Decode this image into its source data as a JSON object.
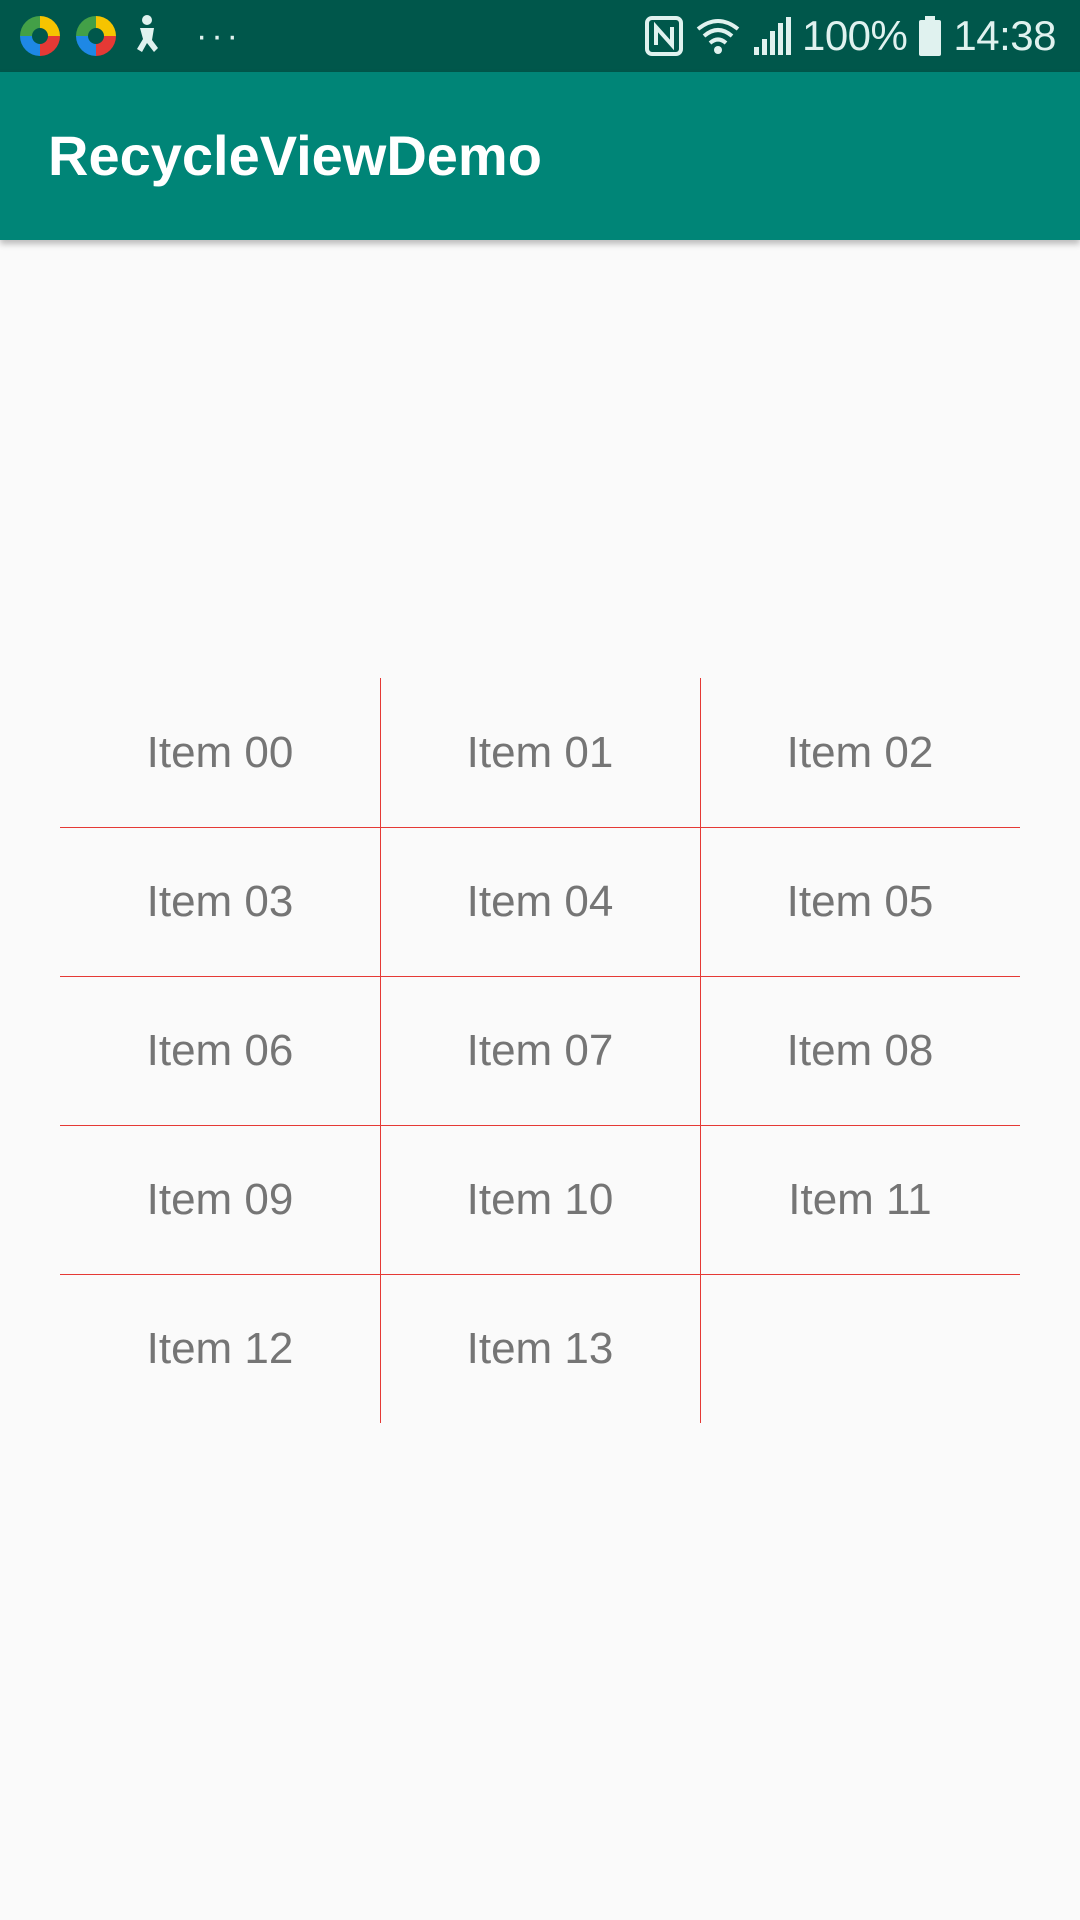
{
  "status_bar": {
    "left_icons": [
      "multicolor-app-icon",
      "multicolor-app-icon",
      "accessibility-icon"
    ],
    "more_indicator": "···",
    "right_icons": [
      "nfc-icon",
      "wifi-icon",
      "cell-signal-icon",
      "battery-icon"
    ],
    "battery": "100%",
    "time": "14:38"
  },
  "app_bar": {
    "title": "RecycleViewDemo"
  },
  "colors": {
    "status_bar": "#00574b",
    "app_bar": "#008577",
    "divider": "#e53935",
    "item_text": "#757575",
    "background": "#fafafa"
  },
  "grid": {
    "columns": 3,
    "items": [
      "Item 00",
      "Item 01",
      "Item 02",
      "Item 03",
      "Item 04",
      "Item 05",
      "Item 06",
      "Item 07",
      "Item 08",
      "Item 09",
      "Item 10",
      "Item 11",
      "Item 12",
      "Item 13"
    ]
  }
}
